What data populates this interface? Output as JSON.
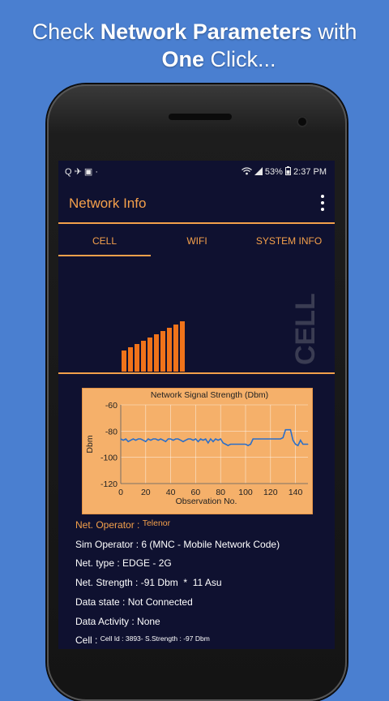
{
  "promo": {
    "line1_prefix": "Check ",
    "line1_bold": "Network Parameters",
    "line1_suffix": " with",
    "line2_bold": "One",
    "line2_suffix": " Click..."
  },
  "status_bar": {
    "left_icons": "Q ✈ ▣ ·",
    "battery": "53%",
    "time": "2:37 PM"
  },
  "app_bar": {
    "title": "Network Info",
    "menu_icon": "overflow-menu-icon"
  },
  "tabs": [
    {
      "label": "CELL",
      "active": true
    },
    {
      "label": "WIFI",
      "active": false
    },
    {
      "label": "SYSTEM INFO",
      "active": false
    }
  ],
  "signal_bars": {
    "count": 10,
    "color": "#f0731a"
  },
  "cell_watermark": "CELL",
  "chart_data": {
    "type": "line",
    "title": "Network Signal Strength (Dbm)",
    "xlabel": "Observation No.",
    "ylabel": "Dbm",
    "xlim": [
      0,
      150
    ],
    "ylim": [
      -120,
      -60
    ],
    "x_ticks": [
      0,
      20,
      40,
      60,
      80,
      100,
      120,
      140
    ],
    "y_ticks": [
      -60,
      -80,
      -100,
      -120
    ],
    "grid": true,
    "line_color": "#2b6fc9",
    "background": "#f5b06a",
    "series": [
      {
        "x": [
          0,
          2,
          4,
          6,
          8,
          10,
          12,
          14,
          16,
          18,
          20,
          22,
          24,
          26,
          28,
          30,
          32,
          34,
          36,
          38,
          40,
          42,
          44,
          46,
          48,
          50,
          52,
          54,
          56,
          58,
          60,
          62,
          64,
          66,
          68,
          70,
          72,
          74,
          76,
          78,
          80,
          82,
          84,
          86,
          88,
          90,
          92,
          94,
          96,
          98,
          100,
          102,
          104,
          106,
          108,
          110,
          112,
          114,
          116,
          118,
          120,
          122,
          124,
          126,
          128,
          130,
          132,
          134,
          136,
          138,
          140,
          142,
          144,
          146,
          148,
          150
        ],
        "y": [
          -86,
          -87,
          -86,
          -88,
          -87,
          -86,
          -87,
          -86,
          -86,
          -87,
          -88,
          -86,
          -87,
          -86,
          -86,
          -87,
          -86,
          -87,
          -88,
          -86,
          -86,
          -87,
          -86,
          -86,
          -87,
          -88,
          -87,
          -86,
          -86,
          -87,
          -86,
          -88,
          -86,
          -87,
          -86,
          -89,
          -86,
          -88,
          -86,
          -87,
          -86,
          -89,
          -90,
          -91,
          -90,
          -90,
          -90,
          -90,
          -90,
          -90,
          -90,
          -91,
          -90,
          -86,
          -86,
          -86,
          -86,
          -86,
          -86,
          -86,
          -86,
          -86,
          -86,
          -86,
          -86,
          -85,
          -79,
          -79,
          -79,
          -87,
          -90,
          -91,
          -87,
          -90,
          -90,
          -90
        ]
      }
    ]
  },
  "info_rows": [
    {
      "label": "Net. Operator :",
      "value": "Telenor",
      "label_color": "#f4a04b",
      "value_color": "#f4a04b",
      "value_size": "small"
    },
    {
      "label": "Sim Operator :",
      "value": "6 (MNC - Mobile Network Code)",
      "label_color": "#ffffff",
      "value_color": "#ffffff",
      "value_size": "normal"
    },
    {
      "label": "Net. type :",
      "value": "EDGE - 2G",
      "label_color": "#ffffff",
      "value_color": "#ffffff",
      "value_size": "normal"
    },
    {
      "label": "Net. Strength :",
      "value": "-91 Dbm  *  11 Asu",
      "label_color": "#ffffff",
      "value_color": "#ffffff",
      "value_size": "normal"
    },
    {
      "label": "Data state :",
      "value": "Not Connected",
      "label_color": "#ffffff",
      "value_color": "#ffffff",
      "value_size": "normal"
    },
    {
      "label": "Data Activity :",
      "value": "None",
      "label_color": "#ffffff",
      "value_color": "#ffffff",
      "value_size": "normal"
    },
    {
      "label": "Cell :",
      "value": "Cell Id : 3893- S.Strength : -97 Dbm",
      "label_color": "#ffffff",
      "value_color": "#ffffff",
      "value_size": "tiny"
    }
  ],
  "colors": {
    "accent": "#f4a04b",
    "screen_bg": "#0f1130",
    "page_bg": "#4a7fd0"
  }
}
